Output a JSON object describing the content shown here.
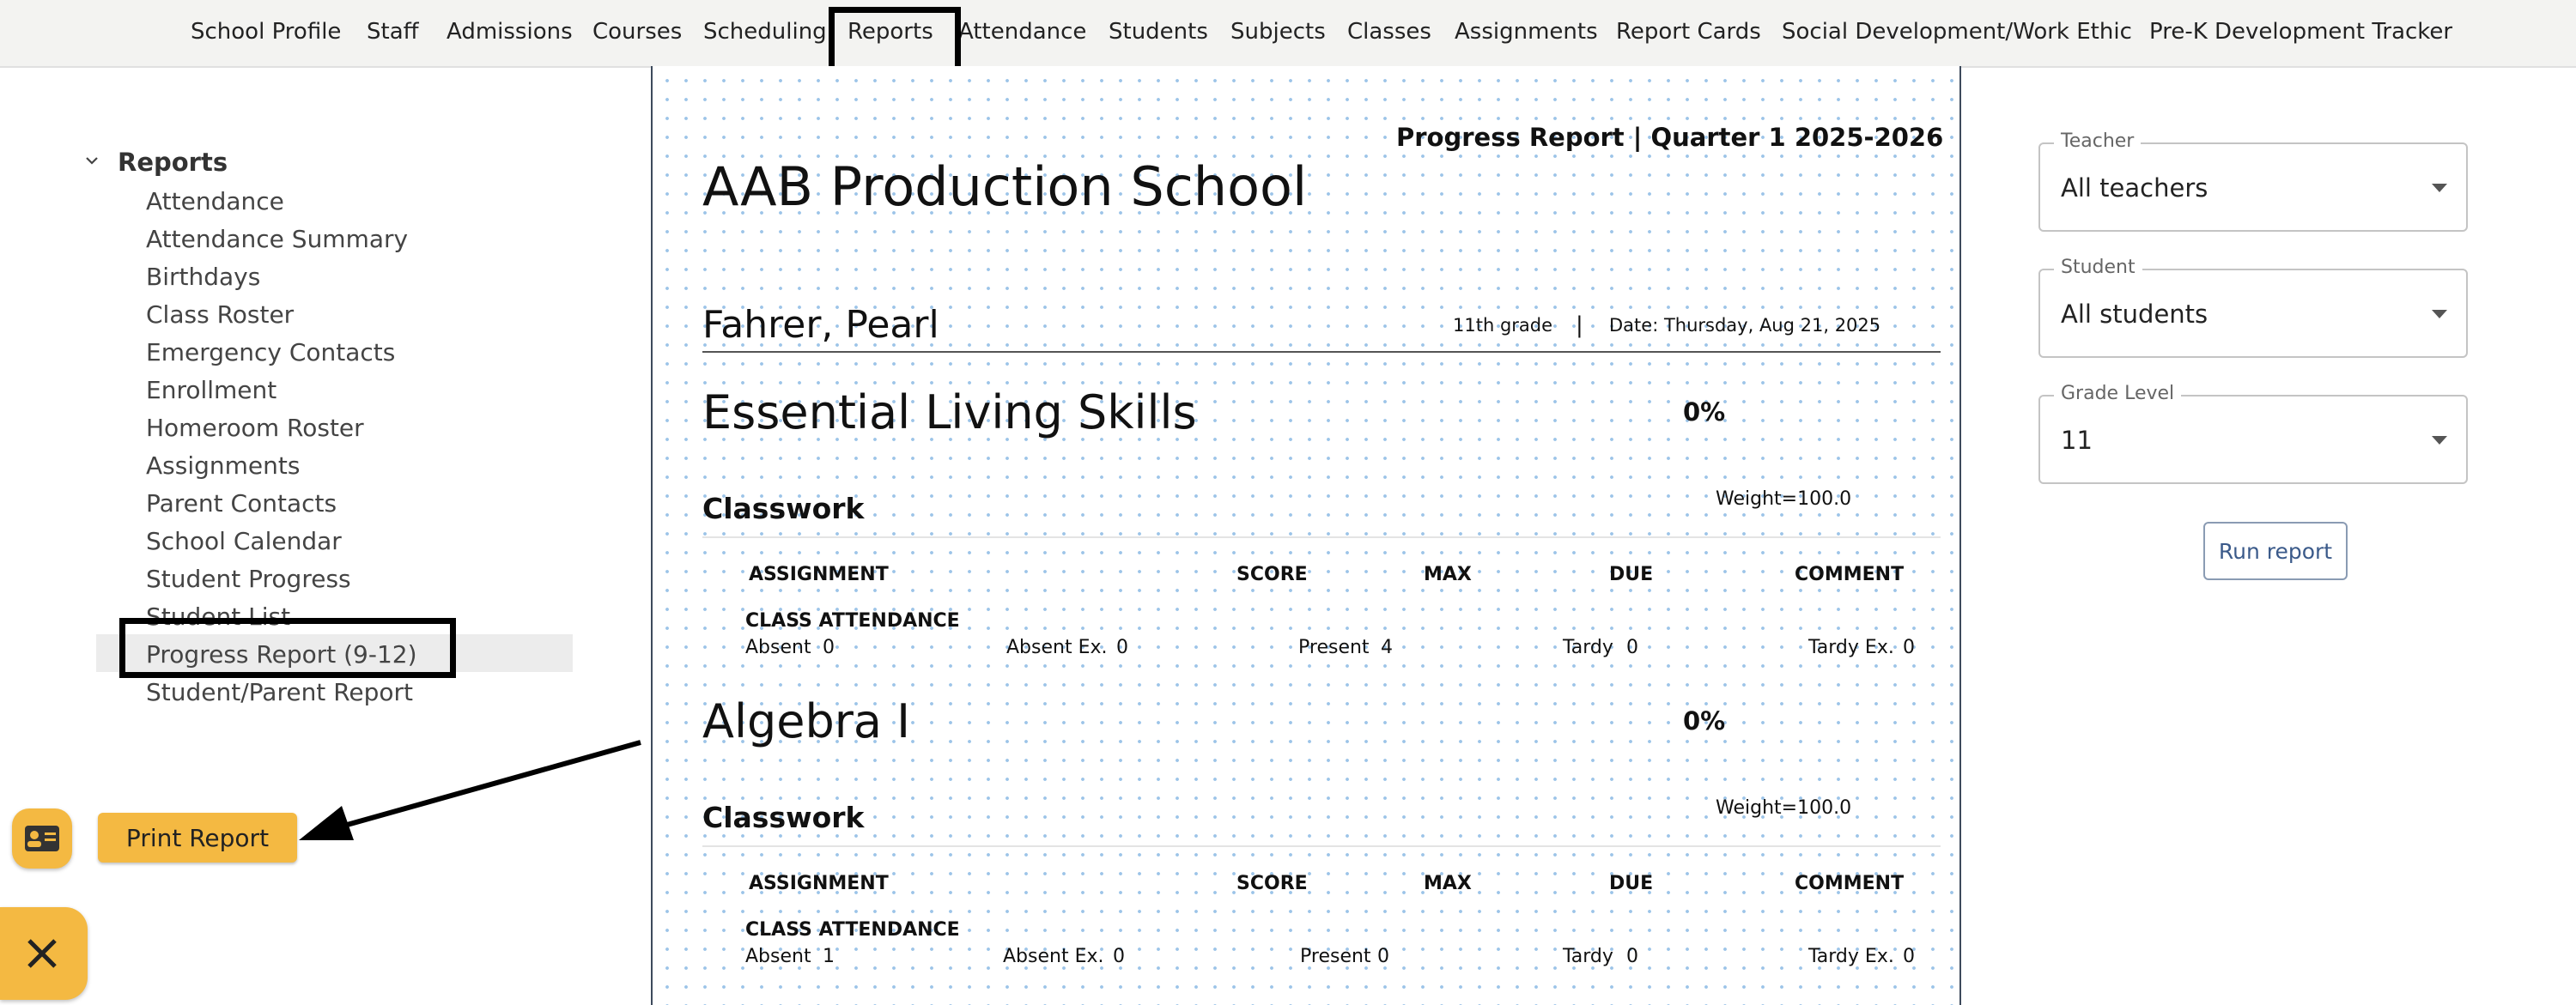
{
  "nav": {
    "items": [
      "School Profile",
      "Staff",
      "Admissions",
      "Courses",
      "Scheduling",
      "Reports",
      "Attendance",
      "Students",
      "Subjects",
      "Classes",
      "Assignments",
      "Report Cards",
      "Social Development/Work Ethic",
      "Pre-K Development Tracker"
    ],
    "active": "Reports"
  },
  "sidebar": {
    "header": "Reports",
    "items": [
      "Attendance",
      "Attendance Summary",
      "Birthdays",
      "Class Roster",
      "Emergency Contacts",
      "Enrollment",
      "Homeroom Roster",
      "Assignments",
      "Parent Contacts",
      "School Calendar",
      "Student Progress",
      "Student List",
      "Progress Report (9-12)",
      "Student/Parent Report"
    ],
    "selected": "Progress Report (9-12)"
  },
  "actions": {
    "print_label": "Print Report",
    "contact_icon": "contact-card-icon",
    "close_icon": "close-icon"
  },
  "report": {
    "title": "Progress Report | Quarter 1 2025-2026",
    "school": "AAB Production School",
    "student": "Fahrer, Pearl",
    "grade": "11th grade",
    "separator": "|",
    "date": "Date: Thursday, Aug 21, 2025",
    "columns": [
      "ASSIGNMENT",
      "SCORE",
      "MAX",
      "DUE",
      "COMMENT"
    ],
    "subjects": [
      {
        "name": "Essential Living Skills",
        "percent": "0%",
        "category": "Classwork",
        "weight": "Weight=100.0",
        "group": "CLASS ATTENDANCE",
        "stats": [
          "Absent",
          "0",
          "Absent Ex.",
          "0",
          "Present",
          "4",
          "Tardy",
          "0",
          "Tardy Ex.",
          "0"
        ]
      },
      {
        "name": "Algebra I",
        "percent": "0%",
        "category": "Classwork",
        "weight": "Weight=100.0",
        "group": "CLASS ATTENDANCE",
        "stats": [
          "Absent",
          "1",
          "Absent Ex.",
          "0",
          "Present",
          "0",
          "Tardy",
          "0",
          "Tardy Ex.",
          "0"
        ]
      }
    ]
  },
  "filters": {
    "teacher": {
      "label": "Teacher",
      "value": "All teachers"
    },
    "student": {
      "label": "Student",
      "value": "All students"
    },
    "grade": {
      "label": "Grade Level",
      "value": "11"
    },
    "run_label": "Run report"
  },
  "colors": {
    "accent": "#f4b942",
    "nav_bg": "#f3f3f1",
    "grid_dot": "#9cc4e8",
    "run_button": "#3b5a8a"
  }
}
